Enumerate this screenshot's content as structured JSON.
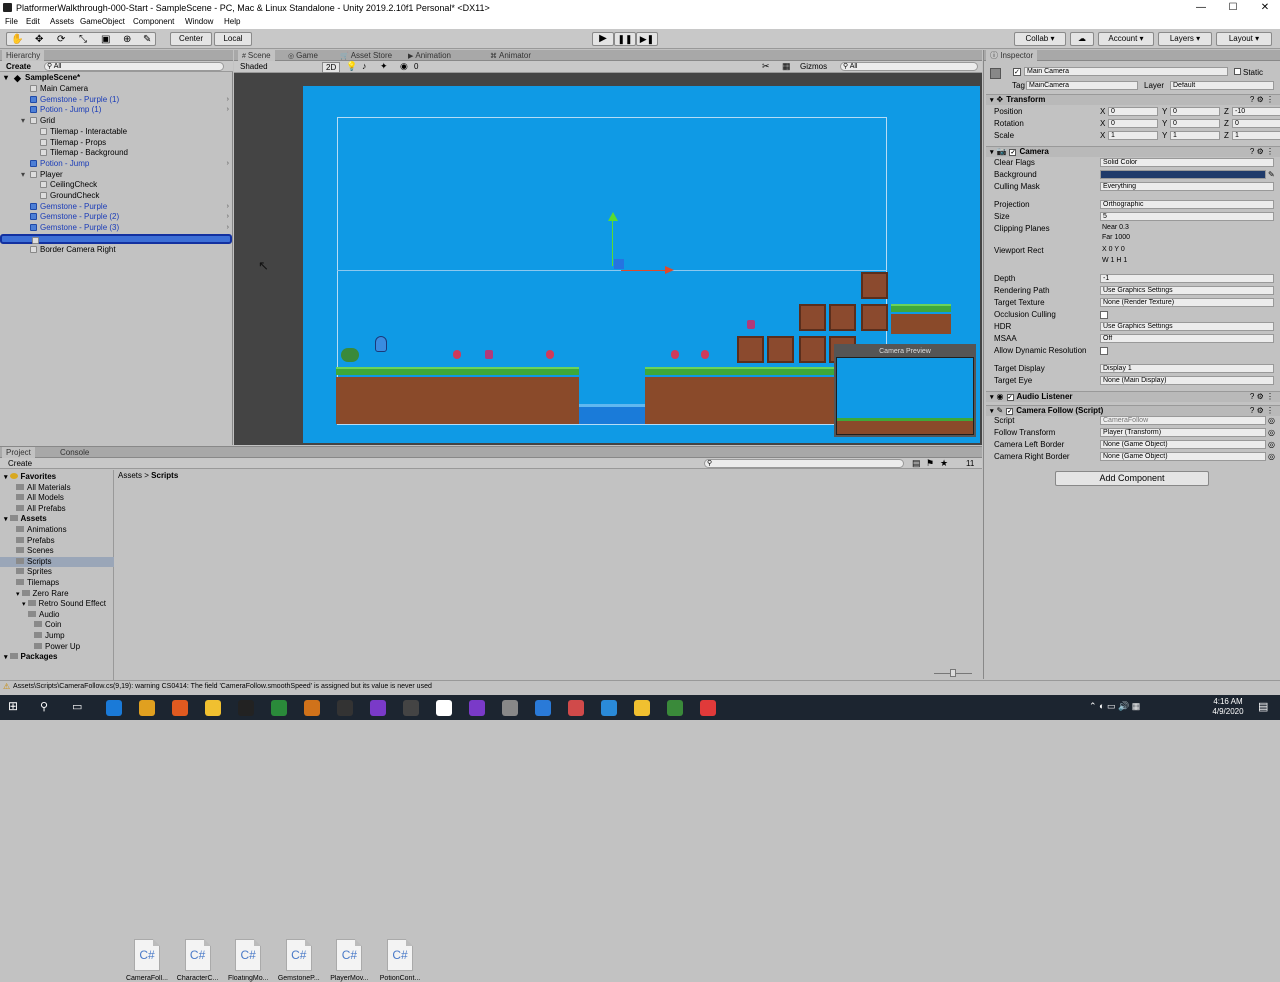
{
  "window": {
    "title": "PlatformerWalkthrough-000-Start - SampleScene - PC, Mac & Linux Standalone - Unity 2019.2.10f1 Personal* <DX11>",
    "min": "—",
    "max": "☐",
    "close": "✕"
  },
  "menu": [
    "File",
    "Edit",
    "Assets",
    "GameObject",
    "Component",
    "Window",
    "Help"
  ],
  "toolbar": {
    "center": "Center",
    "local": "Local",
    "collab": "Collab",
    "account": "Account",
    "layers": "Layers",
    "layout": "Layout"
  },
  "hierarchy": {
    "tab": "Hierarchy",
    "create": "Create",
    "search": "All",
    "scene": "SampleScene*",
    "items": [
      {
        "label": "Main Camera",
        "indent": 1,
        "blue": false
      },
      {
        "label": "Gemstone - Purple (1)",
        "indent": 1,
        "blue": true
      },
      {
        "label": "Potion - Jump (1)",
        "indent": 1,
        "blue": true
      },
      {
        "label": "Grid",
        "indent": 1,
        "blue": false
      },
      {
        "label": "Tilemap - Interactable",
        "indent": 2,
        "blue": false
      },
      {
        "label": "Tilemap - Props",
        "indent": 2,
        "blue": false
      },
      {
        "label": "Tilemap - Background",
        "indent": 2,
        "blue": false
      },
      {
        "label": "Potion - Jump",
        "indent": 1,
        "blue": true
      },
      {
        "label": "Player",
        "indent": 1,
        "blue": false
      },
      {
        "label": "CeilingCheck",
        "indent": 2,
        "blue": false
      },
      {
        "label": "GroundCheck",
        "indent": 2,
        "blue": false
      },
      {
        "label": "Gemstone - Purple",
        "indent": 1,
        "blue": true
      },
      {
        "label": "Gemstone - Purple (2)",
        "indent": 1,
        "blue": true
      },
      {
        "label": "Gemstone - Purple (3)",
        "indent": 1,
        "blue": true
      },
      {
        "label": "",
        "indent": 1,
        "blue": false
      },
      {
        "label": "Border Camera Right",
        "indent": 1,
        "blue": false
      }
    ]
  },
  "scene": {
    "tabs": [
      "Scene",
      "Game",
      "Asset Store",
      "Animation",
      "Animator"
    ],
    "shaded": "Shaded",
    "mode2d": "2D",
    "gizmos": "Gizmos",
    "search": "All",
    "preview": "Camera Preview",
    "zero": "0"
  },
  "project": {
    "tabs": [
      "Project",
      "Console"
    ],
    "create": "Create",
    "breadcrumb": [
      "Assets",
      "Scripts"
    ],
    "count": "11",
    "tree": [
      {
        "label": "Favorites",
        "bold": true,
        "indent": 0
      },
      {
        "label": "All Materials",
        "indent": 2
      },
      {
        "label": "All Models",
        "indent": 2
      },
      {
        "label": "All Prefabs",
        "indent": 2
      },
      {
        "label": "Assets",
        "bold": true,
        "indent": 0
      },
      {
        "label": "Animations",
        "indent": 2
      },
      {
        "label": "Prefabs",
        "indent": 2
      },
      {
        "label": "Scenes",
        "indent": 2
      },
      {
        "label": "Scripts",
        "indent": 2,
        "sel": true
      },
      {
        "label": "Sprites",
        "indent": 2
      },
      {
        "label": "Tilemaps",
        "indent": 2
      },
      {
        "label": "Zero Rare",
        "indent": 2
      },
      {
        "label": "Retro Sound Effect",
        "indent": 3
      },
      {
        "label": "Audio",
        "indent": 4
      },
      {
        "label": "Coin",
        "indent": 5
      },
      {
        "label": "Jump",
        "indent": 5
      },
      {
        "label": "Power Up",
        "indent": 5
      },
      {
        "label": "Packages",
        "bold": true,
        "indent": 0
      }
    ],
    "files": [
      {
        "icon": "C#",
        "name": "CameraFoll..."
      },
      {
        "icon": "C#",
        "name": "CharacterC..."
      },
      {
        "icon": "C#",
        "name": "FloatingMo..."
      },
      {
        "icon": "C#",
        "name": "GemstoneP..."
      },
      {
        "icon": "C#",
        "name": "PlayerMov..."
      },
      {
        "icon": "C#",
        "name": "PotionCont..."
      }
    ]
  },
  "inspector": {
    "tab": "Inspector",
    "name": "Main Camera",
    "static": "Static",
    "tag_label": "Tag",
    "tag": "MainCamera",
    "layer_label": "Layer",
    "layer": "Default",
    "transform": {
      "title": "Transform",
      "rows": [
        {
          "label": "Position",
          "x": "0",
          "y": "0",
          "z": "-10"
        },
        {
          "label": "Rotation",
          "x": "0",
          "y": "0",
          "z": "0"
        },
        {
          "label": "Scale",
          "x": "1",
          "y": "1",
          "z": "1"
        }
      ]
    },
    "camera": {
      "title": "Camera",
      "rows": [
        {
          "label": "Clear Flags",
          "value": "Solid Color"
        },
        {
          "label": "Background",
          "value": ""
        },
        {
          "label": "Culling Mask",
          "value": "Everything"
        },
        {
          "label": "Projection",
          "value": "Orthographic"
        },
        {
          "label": "Size",
          "value": "5"
        },
        {
          "label": "Clipping Planes",
          "value": "Near  0.3"
        },
        {
          "label": "",
          "value": "Far   1000"
        },
        {
          "label": "Viewport Rect",
          "value": "X 0          Y 0"
        },
        {
          "label": "",
          "value": "W 1          H 1"
        },
        {
          "label": "Depth",
          "value": "-1"
        },
        {
          "label": "Rendering Path",
          "value": "Use Graphics Settings"
        },
        {
          "label": "Target Texture",
          "value": "None (Render Texture)"
        },
        {
          "label": "Occlusion Culling",
          "value": ""
        },
        {
          "label": "HDR",
          "value": "Use Graphics Settings"
        },
        {
          "label": "MSAA",
          "value": "Off"
        },
        {
          "label": "Allow Dynamic Resolution",
          "value": ""
        },
        {
          "label": "Target Display",
          "value": "Display 1"
        },
        {
          "label": "Target Eye",
          "value": "None (Main Display)"
        }
      ]
    },
    "audio": {
      "title": "Audio Listener"
    },
    "follow": {
      "title": "Camera Follow (Script)",
      "rows": [
        {
          "label": "Script",
          "value": "CameraFollow"
        },
        {
          "label": "Follow Transform",
          "value": "Player (Transform)"
        },
        {
          "label": "Camera Left Border",
          "value": "None (Game Object)"
        },
        {
          "label": "Camera Right Border",
          "value": "None (Game Object)"
        }
      ]
    },
    "add_component": "Add Component"
  },
  "status": "Assets\\Scripts\\CameraFollow.cs(9,19): warning CS0414: The field 'CameraFollow.smoothSpeed' is assigned but its value is never used",
  "clock": {
    "time": "4:16 AM",
    "date": "4/9/2020"
  },
  "colors": {
    "scene_bg": "#0f9ae5",
    "camera_bg": "#1f3a6a",
    "selection": "#3d6fd6"
  }
}
